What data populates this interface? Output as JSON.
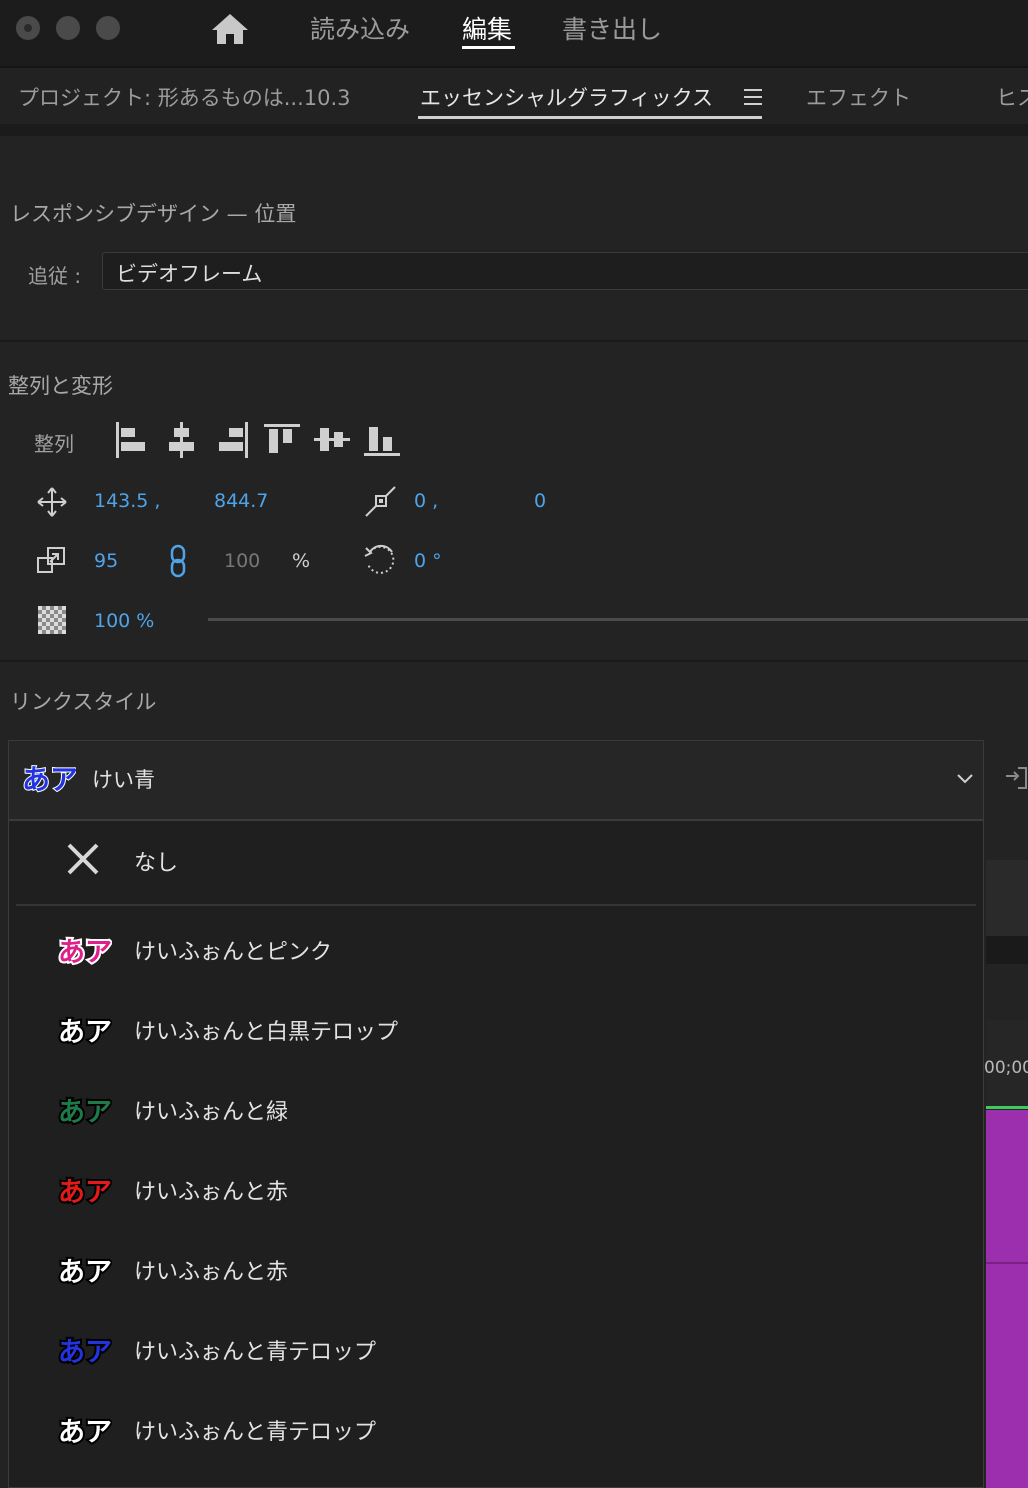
{
  "header": {
    "tabs": [
      {
        "label": "読み込み"
      },
      {
        "label": "編集",
        "active": true
      },
      {
        "label": "書き出し"
      }
    ]
  },
  "panel_tabs": {
    "project": "プロジェクト: 形あるものは...10.3",
    "essential_graphics": "エッセンシャルグラフィックス",
    "effects": "エフェクト",
    "history_partial": "ヒス"
  },
  "responsive": {
    "title": "レスポンシブデザイン — 位置",
    "follow_label": "追従 :",
    "follow_value": "ビデオフレーム"
  },
  "transform": {
    "title": "整列と変形",
    "align_label": "整列",
    "position_x": "143.5 ,",
    "position_y": "844.7",
    "anchor_x": "0 ,",
    "anchor_y": "0",
    "scale": "95",
    "scale_height": "100",
    "percent": "%",
    "rotation": "0 °",
    "opacity": "100 %"
  },
  "link_style": {
    "title": "リンクスタイル",
    "selected": "けい青",
    "swatch_text": "あア",
    "items": [
      {
        "label": "なし",
        "type": "none"
      },
      {
        "label": "けいふぉんとピンク",
        "color": "#e0208a",
        "stroke": "#ffffff"
      },
      {
        "label": "けいふぉんと白黒テロップ",
        "color": "#ffffff",
        "stroke": "#000000"
      },
      {
        "label": "けいふぉんと緑",
        "color": "#1f7a4a",
        "stroke": "#000000"
      },
      {
        "label": "けいふぉんと赤",
        "color": "#e41a1a",
        "stroke": "#000000"
      },
      {
        "label": "けいふぉんと赤",
        "color": "#ffffff",
        "stroke": "#000000"
      },
      {
        "label": "けいふぉんと青テロップ",
        "color": "#2233e0",
        "stroke": "#000000"
      },
      {
        "label": "けいふぉんと青テロップ",
        "color": "#ffffff",
        "stroke": "#000000"
      }
    ]
  },
  "timeline": {
    "timecode_partial": "00;00"
  },
  "colors": {
    "accent_blue": "#4fa3e8",
    "clip_purple": "#9b2fae",
    "playhead_green": "#3dcb5a"
  }
}
